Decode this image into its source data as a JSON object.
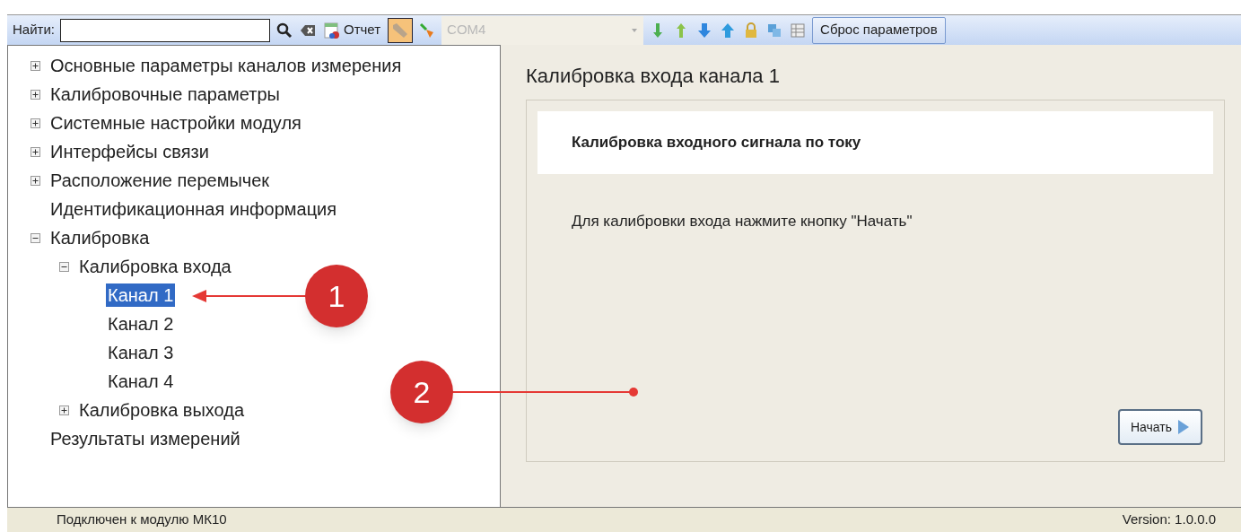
{
  "toolbar": {
    "search_label": "Найти:",
    "report_button": "Отчет",
    "connect_toggle": {
      "on": true
    },
    "port_combo": {
      "value": "COM4",
      "disabled": true
    },
    "reset_button": "Сброс параметров"
  },
  "tree": [
    {
      "label": "Основные параметры каналов измерения",
      "expanded": false,
      "selected": false
    },
    {
      "label": "Калибровочные параметры",
      "expanded": false,
      "selected": false
    },
    {
      "label": "Системные настройки модуля",
      "expanded": false,
      "selected": false
    },
    {
      "label": "Интерфейсы связи",
      "expanded": false,
      "selected": false
    },
    {
      "label": "Расположение перемычек",
      "expanded": false,
      "selected": false
    },
    {
      "label": "Идентификационная информация",
      "selected": false
    },
    {
      "label": "Калибровка",
      "expanded": true,
      "selected": false,
      "children": [
        {
          "label": "Калибровка входа",
          "expanded": true,
          "selected": false,
          "children": [
            {
              "label": "Канал 1",
              "selected": true
            },
            {
              "label": "Канал 2",
              "selected": false
            },
            {
              "label": "Канал 3",
              "selected": false
            },
            {
              "label": "Канал 4",
              "selected": false
            }
          ]
        },
        {
          "label": "Калибровка выхода",
          "expanded": false,
          "selected": false
        }
      ]
    },
    {
      "label": "Результаты измерений",
      "selected": false
    }
  ],
  "content": {
    "title": "Калибровка входа канала 1",
    "section_heading": "Калибровка входного сигнала по току",
    "message": "Для калибровки входа нажмите кнопку \"Начать\"",
    "start_button": "Начать"
  },
  "callouts": [
    {
      "label": "1"
    },
    {
      "label": "2"
    }
  ],
  "status_bar": {
    "connection": "Подключен к модулю МК10",
    "version": "Version: 1.0.0.0"
  }
}
